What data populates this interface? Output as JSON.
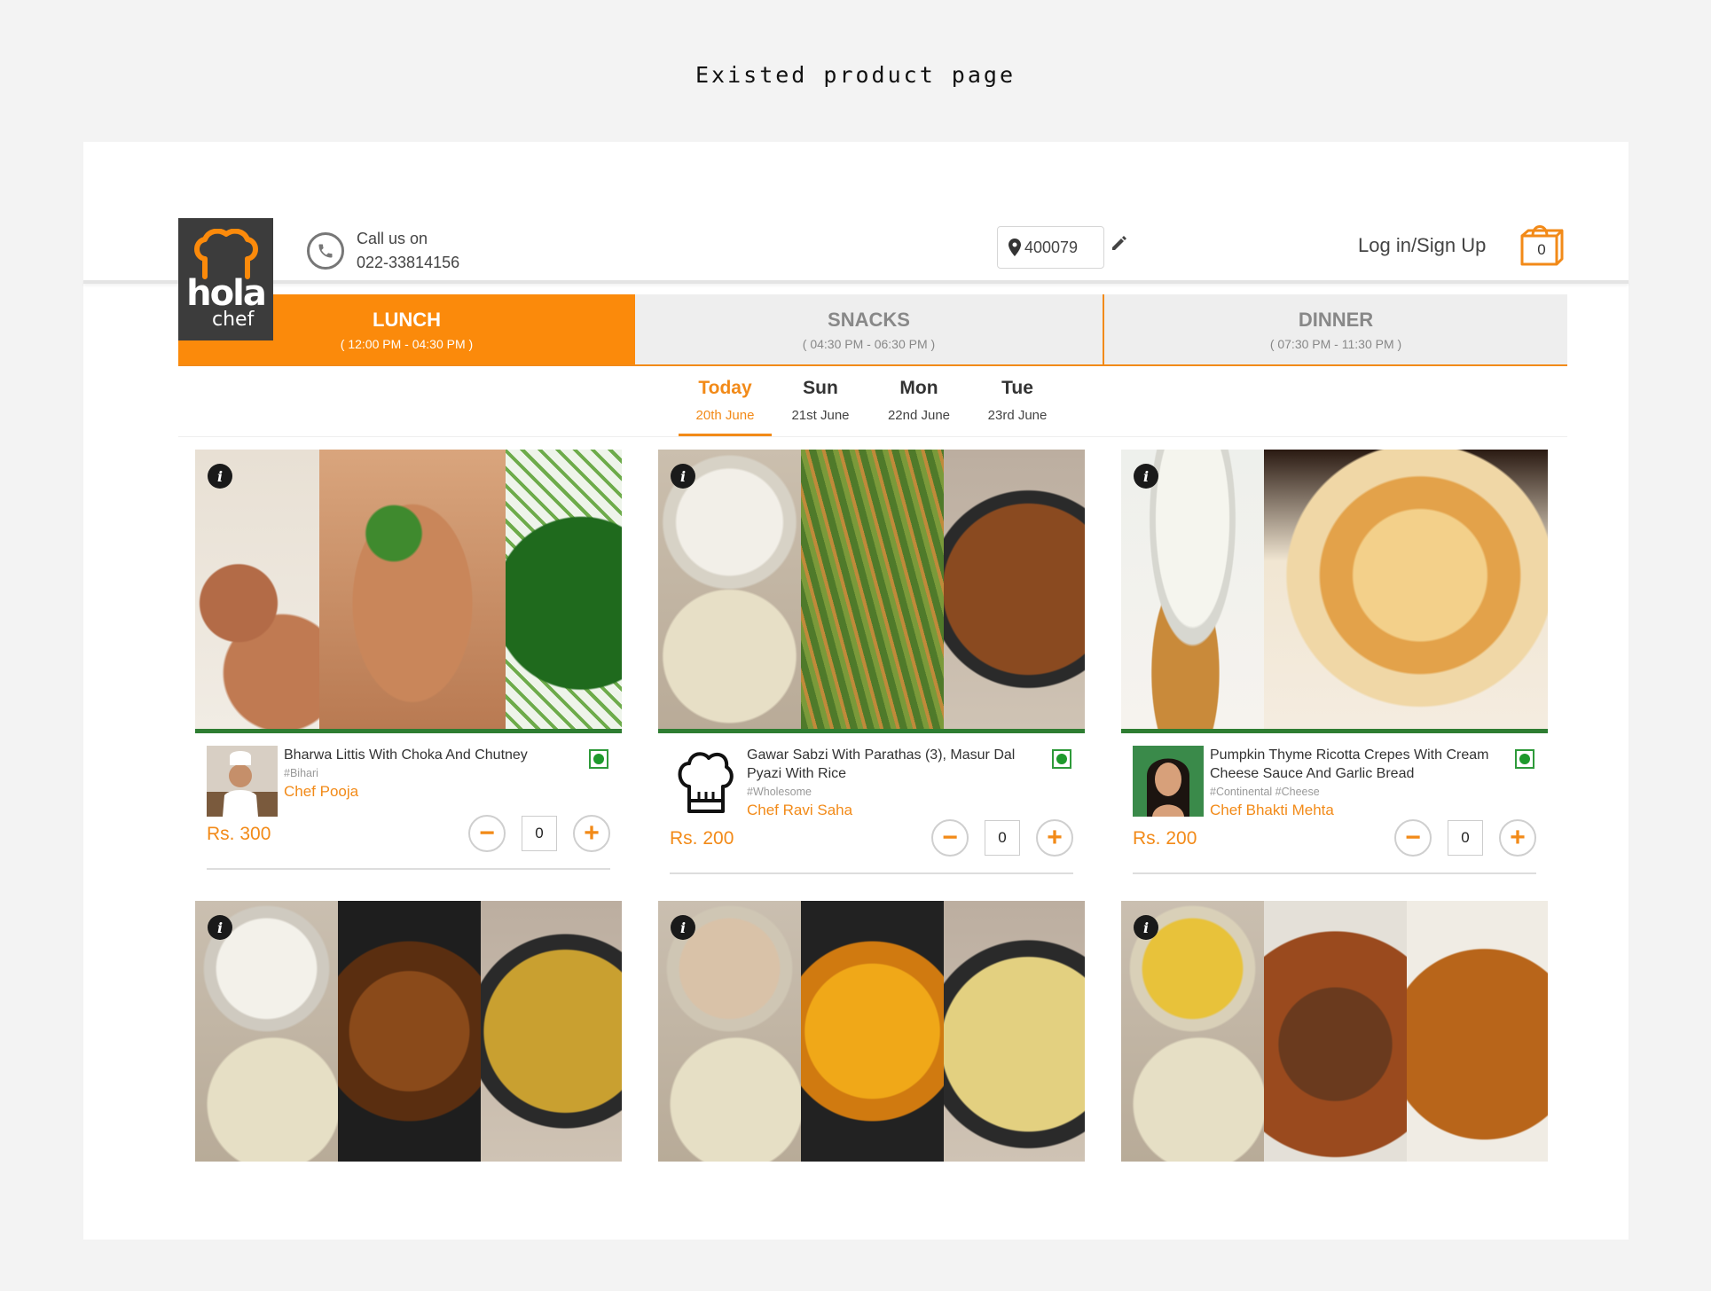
{
  "caption": "Existed product page",
  "header": {
    "logo_text": "hola",
    "logo_sub": "chef",
    "call_label": "Call us on",
    "phone": "022-33814156",
    "pincode": "400079",
    "login": "Log in/Sign Up",
    "cart_count": "0"
  },
  "meal_tabs": [
    {
      "name": "LUNCH",
      "time": "( 12:00 PM - 04:30 PM )"
    },
    {
      "name": "SNACKS",
      "time": "( 04:30 PM - 06:30 PM )"
    },
    {
      "name": "DINNER",
      "time": "( 07:30 PM - 11:30 PM )"
    }
  ],
  "dates": [
    {
      "day": "Today",
      "date": "20th June"
    },
    {
      "day": "Sun",
      "date": "21st June"
    },
    {
      "day": "Mon",
      "date": "22nd June"
    },
    {
      "day": "Tue",
      "date": "23rd June"
    }
  ],
  "products": [
    {
      "title": "Bharwa Littis With Choka And Chutney",
      "tags": "#Bihari",
      "chef": "Chef Pooja",
      "price": "Rs. 300",
      "qty": "0"
    },
    {
      "title": "Gawar Sabzi With Parathas (3), Masur Dal Pyazi With Rice",
      "tags": "#Wholesome",
      "chef": "Chef Ravi Saha",
      "price": "Rs. 200",
      "qty": "0"
    },
    {
      "title": "Pumpkin Thyme Ricotta Crepes With Cream Cheese Sauce And Garlic Bread",
      "tags": "#Continental #Cheese",
      "chef": "Chef Bhakti Mehta",
      "price": "Rs. 200",
      "qty": "0"
    }
  ],
  "icons": {
    "info": "i",
    "minus": "−",
    "plus": "+"
  },
  "colors": {
    "accent": "#fb8a0b",
    "veg": "#1e9a2c",
    "image_border": "#2e7d32"
  }
}
